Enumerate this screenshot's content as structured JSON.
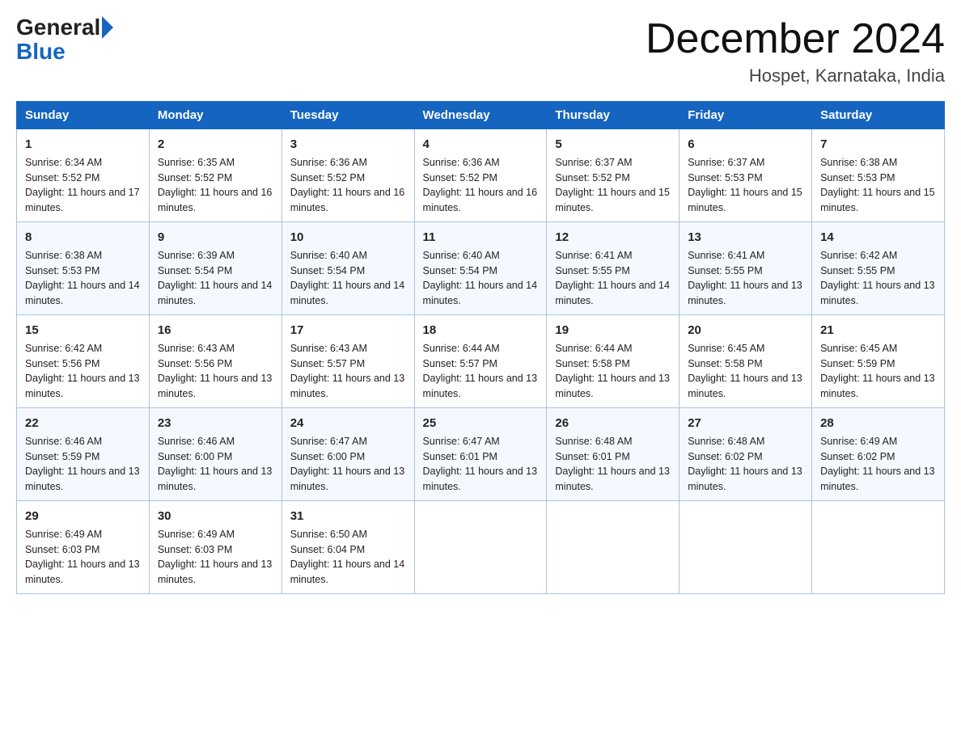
{
  "header": {
    "logo_general": "General",
    "logo_blue": "Blue",
    "month_year": "December 2024",
    "location": "Hospet, Karnataka, India"
  },
  "days_of_week": [
    "Sunday",
    "Monday",
    "Tuesday",
    "Wednesday",
    "Thursday",
    "Friday",
    "Saturday"
  ],
  "weeks": [
    [
      {
        "day": "1",
        "sunrise": "6:34 AM",
        "sunset": "5:52 PM",
        "daylight": "11 hours and 17 minutes."
      },
      {
        "day": "2",
        "sunrise": "6:35 AM",
        "sunset": "5:52 PM",
        "daylight": "11 hours and 16 minutes."
      },
      {
        "day": "3",
        "sunrise": "6:36 AM",
        "sunset": "5:52 PM",
        "daylight": "11 hours and 16 minutes."
      },
      {
        "day": "4",
        "sunrise": "6:36 AM",
        "sunset": "5:52 PM",
        "daylight": "11 hours and 16 minutes."
      },
      {
        "day": "5",
        "sunrise": "6:37 AM",
        "sunset": "5:52 PM",
        "daylight": "11 hours and 15 minutes."
      },
      {
        "day": "6",
        "sunrise": "6:37 AM",
        "sunset": "5:53 PM",
        "daylight": "11 hours and 15 minutes."
      },
      {
        "day": "7",
        "sunrise": "6:38 AM",
        "sunset": "5:53 PM",
        "daylight": "11 hours and 15 minutes."
      }
    ],
    [
      {
        "day": "8",
        "sunrise": "6:38 AM",
        "sunset": "5:53 PM",
        "daylight": "11 hours and 14 minutes."
      },
      {
        "day": "9",
        "sunrise": "6:39 AM",
        "sunset": "5:54 PM",
        "daylight": "11 hours and 14 minutes."
      },
      {
        "day": "10",
        "sunrise": "6:40 AM",
        "sunset": "5:54 PM",
        "daylight": "11 hours and 14 minutes."
      },
      {
        "day": "11",
        "sunrise": "6:40 AM",
        "sunset": "5:54 PM",
        "daylight": "11 hours and 14 minutes."
      },
      {
        "day": "12",
        "sunrise": "6:41 AM",
        "sunset": "5:55 PM",
        "daylight": "11 hours and 14 minutes."
      },
      {
        "day": "13",
        "sunrise": "6:41 AM",
        "sunset": "5:55 PM",
        "daylight": "11 hours and 13 minutes."
      },
      {
        "day": "14",
        "sunrise": "6:42 AM",
        "sunset": "5:55 PM",
        "daylight": "11 hours and 13 minutes."
      }
    ],
    [
      {
        "day": "15",
        "sunrise": "6:42 AM",
        "sunset": "5:56 PM",
        "daylight": "11 hours and 13 minutes."
      },
      {
        "day": "16",
        "sunrise": "6:43 AM",
        "sunset": "5:56 PM",
        "daylight": "11 hours and 13 minutes."
      },
      {
        "day": "17",
        "sunrise": "6:43 AM",
        "sunset": "5:57 PM",
        "daylight": "11 hours and 13 minutes."
      },
      {
        "day": "18",
        "sunrise": "6:44 AM",
        "sunset": "5:57 PM",
        "daylight": "11 hours and 13 minutes."
      },
      {
        "day": "19",
        "sunrise": "6:44 AM",
        "sunset": "5:58 PM",
        "daylight": "11 hours and 13 minutes."
      },
      {
        "day": "20",
        "sunrise": "6:45 AM",
        "sunset": "5:58 PM",
        "daylight": "11 hours and 13 minutes."
      },
      {
        "day": "21",
        "sunrise": "6:45 AM",
        "sunset": "5:59 PM",
        "daylight": "11 hours and 13 minutes."
      }
    ],
    [
      {
        "day": "22",
        "sunrise": "6:46 AM",
        "sunset": "5:59 PM",
        "daylight": "11 hours and 13 minutes."
      },
      {
        "day": "23",
        "sunrise": "6:46 AM",
        "sunset": "6:00 PM",
        "daylight": "11 hours and 13 minutes."
      },
      {
        "day": "24",
        "sunrise": "6:47 AM",
        "sunset": "6:00 PM",
        "daylight": "11 hours and 13 minutes."
      },
      {
        "day": "25",
        "sunrise": "6:47 AM",
        "sunset": "6:01 PM",
        "daylight": "11 hours and 13 minutes."
      },
      {
        "day": "26",
        "sunrise": "6:48 AM",
        "sunset": "6:01 PM",
        "daylight": "11 hours and 13 minutes."
      },
      {
        "day": "27",
        "sunrise": "6:48 AM",
        "sunset": "6:02 PM",
        "daylight": "11 hours and 13 minutes."
      },
      {
        "day": "28",
        "sunrise": "6:49 AM",
        "sunset": "6:02 PM",
        "daylight": "11 hours and 13 minutes."
      }
    ],
    [
      {
        "day": "29",
        "sunrise": "6:49 AM",
        "sunset": "6:03 PM",
        "daylight": "11 hours and 13 minutes."
      },
      {
        "day": "30",
        "sunrise": "6:49 AM",
        "sunset": "6:03 PM",
        "daylight": "11 hours and 13 minutes."
      },
      {
        "day": "31",
        "sunrise": "6:50 AM",
        "sunset": "6:04 PM",
        "daylight": "11 hours and 14 minutes."
      },
      null,
      null,
      null,
      null
    ]
  ],
  "labels": {
    "sunrise": "Sunrise:",
    "sunset": "Sunset:",
    "daylight": "Daylight:"
  }
}
